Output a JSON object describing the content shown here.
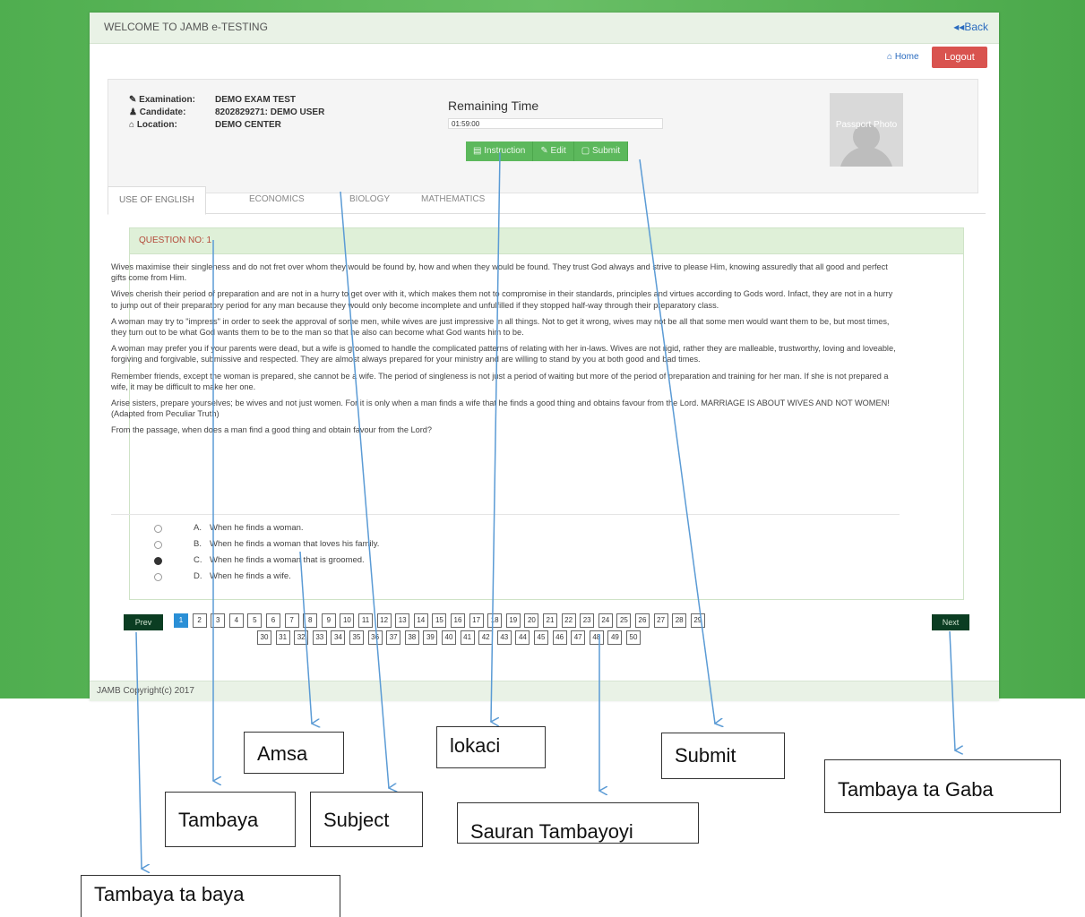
{
  "window": {
    "title": "WELCOME TO JAMB e-TESTING",
    "back_label": "Back"
  },
  "header": {
    "home_label": "Home",
    "logout_label": "Logout"
  },
  "info": {
    "examination_label": "Examination:",
    "examination_value": "DEMO EXAM TEST",
    "candidate_label": "Candidate:",
    "candidate_value": "8202829271: DEMO USER",
    "location_label": "Location:",
    "location_value": "DEMO CENTER"
  },
  "timer": {
    "title": "Remaining Time",
    "value": "01:59:00"
  },
  "actions": {
    "instruction": "Instruction",
    "edit": "Edit",
    "submit": "Submit"
  },
  "passport": {
    "text": "Passport Photo"
  },
  "tabs": [
    "USE OF ENGLISH",
    "ECONOMICS",
    "BIOLOGY",
    "MATHEMATICS"
  ],
  "question": {
    "header": "QUESTION NO: 1",
    "paragraphs": [
      "Wives maximise their singleness and do not fret over whom they would be found by, how and when they would be found. They trust God always and strive to please Him, knowing assuredly that all good and perfect gifts come from Him.",
      "Wives cherish their period of preparation and are not in a hurry to get over with it, which makes them not to compromise in their standards, principles and virtues according to Gods word. Infact, they are not in a hurry to jump out of their preparatory period for any man because they would only become incomplete and unfulfilled if they stopped half-way through their preparatory class.",
      "A woman may try to \"impress\" in order to seek the approval of some men, while wives are just impressive in all things. Not to get it wrong, wives may not be all that some men would want them to be, but most times, they turn out to be what God wants them to be to the man so that he also can become what God wants him to be.",
      "A woman may prefer you if your parents were dead, but a wife is groomed to handle the complicated patterns of relating with her in-laws. Wives are not rigid, rather they are malleable, trustworthy, loving and loveable, forgiving and forgivable, submissive and respected. They are almost always prepared for your ministry and are willing to stand by you at both good and bad times.",
      "Remember friends, except the woman is prepared, she cannot be a wife. The period of singleness is not just a period of waiting but more of the period of preparation and training for her man. If she is not prepared a wife, it may be difficult to make her one.",
      "Arise sisters, prepare yourselves; be wives and not just women. For it is only when a man finds a wife that he finds a good thing and obtains favour from the Lord. MARRIAGE IS ABOUT WIVES AND NOT WOMEN!",
      "(Adapted from Peculiar Truth)",
      "From the passage, when does a man find a good thing and obtain favour from the Lord?"
    ],
    "options": [
      {
        "letter": "A.",
        "text": "When he finds a woman.",
        "selected": false
      },
      {
        "letter": "B.",
        "text": "When he finds a woman that loves his family.",
        "selected": false
      },
      {
        "letter": "C.",
        "text": "When he finds a woman that is groomed.",
        "selected": true
      },
      {
        "letter": "D.",
        "text": "When he finds a wife.",
        "selected": false
      }
    ]
  },
  "pager": {
    "prev_label": "Prev",
    "next_label": "Next",
    "current": 1,
    "row1": [
      "1",
      "2",
      "3",
      "4",
      "5",
      "6",
      "7",
      "8",
      "9",
      "10",
      "11",
      "12",
      "13",
      "14",
      "15",
      "16",
      "17",
      "18",
      "19",
      "20",
      "21",
      "22",
      "23",
      "24",
      "25",
      "26",
      "27",
      "28",
      "29"
    ],
    "row2": [
      "30",
      "31",
      "32",
      "33",
      "34",
      "35",
      "36",
      "37",
      "38",
      "39",
      "40",
      "41",
      "42",
      "43",
      "44",
      "45",
      "46",
      "47",
      "48",
      "49",
      "50"
    ]
  },
  "footer": {
    "text": "JAMB Copyright(c) 2017"
  },
  "callouts": {
    "amsa": "Amsa",
    "lokaci": "lokaci",
    "submit": "Submit",
    "tambaya_ta_gaba": "Tambaya ta Gaba",
    "tambaya": "Tambaya",
    "subject": "Subject",
    "sauran_tambayoyi": "Sauran Tambayoyi",
    "tambaya_ta_baya": "Tambaya ta  baya"
  },
  "colors": {
    "brand_green": "#5cb85c",
    "logout_red": "#d9534f",
    "nav_dark": "#0b3d22",
    "current_blue": "#2a8fd6",
    "arrow_blue": "#5b9bd5"
  }
}
